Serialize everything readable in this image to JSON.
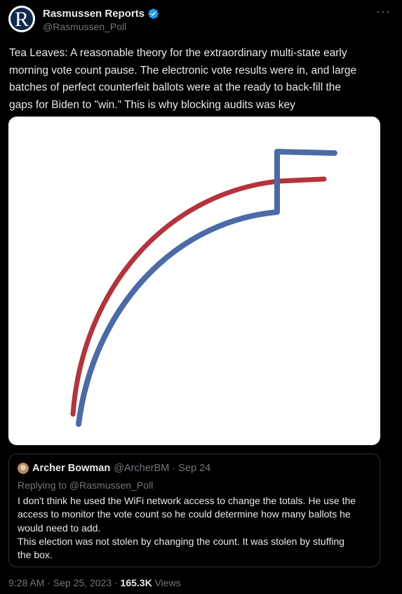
{
  "author": {
    "display_name": "Rasmussen Reports",
    "handle": "@Rasmussen_Poll",
    "avatar_letter": "R",
    "verified": true
  },
  "tweet": {
    "text": "Tea Leaves: A reasonable theory for the extraordinary multi-state early\nmorning vote count pause. The electronic vote results were in, and large\nbatches of perfect counterfeit ballots were at the ready to back-fill the\ngaps for Biden to \"win.\" This is why blocking audits was key"
  },
  "media": {
    "type": "line",
    "series": [
      {
        "color": "#b5333b"
      },
      {
        "color": "#4a6aa8"
      }
    ]
  },
  "quoted_tweet": {
    "author_name": "Archer Bowman",
    "meta": "@ArcherBM · Sep 24",
    "replying_to": "Replying to @Rasmussen_Poll",
    "text": "I don't think he used the WiFi network access to change the totals. He use the\naccess to monitor the vote count so he could determine how many ballots he\nwould need to add.\nThis election was not stolen by changing the count. It was stolen by stuffing\nthe box."
  },
  "footer": {
    "timestamp": "9:28 AM · Sep 25, 2023 · ",
    "views_count": "165.3K",
    "views_label": " Views"
  },
  "icons": {
    "verified": "verified-badge-icon",
    "more": "more-options-icon"
  }
}
